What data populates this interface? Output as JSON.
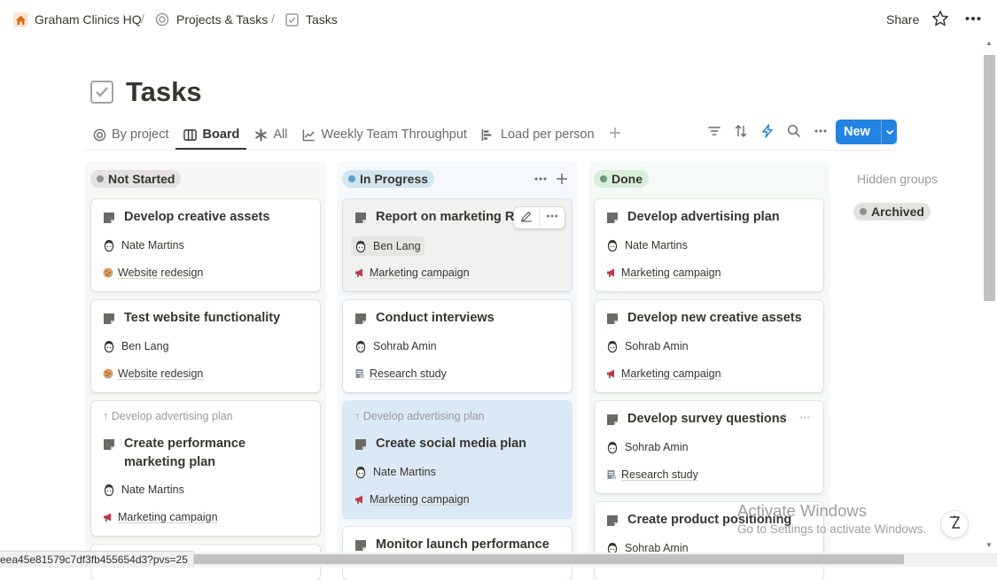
{
  "breadcrumb": {
    "workspace": "Graham Clinics HQ",
    "section": "Projects & Tasks",
    "page": "Tasks",
    "separator": "/"
  },
  "topbar": {
    "share_label": "Share"
  },
  "page": {
    "title": "Tasks"
  },
  "views": [
    {
      "label": "By project",
      "icon": "target-icon"
    },
    {
      "label": "Board",
      "icon": "board-icon",
      "active": true
    },
    {
      "label": "All",
      "icon": "asterisk-icon"
    },
    {
      "label": "Weekly Team Throughput",
      "icon": "line-chart-icon"
    },
    {
      "label": "Load per person",
      "icon": "bar-chart-icon"
    }
  ],
  "toolbar": {
    "new_label": "New"
  },
  "columns": [
    {
      "label": "Not Started",
      "dot_color": "#91918e",
      "pill_bg": "#e3e2e0",
      "cards": [
        {
          "title": "Develop creative assets",
          "assignee": "Nate Martins",
          "project": "Website redesign",
          "project_icon": "cookie-icon"
        },
        {
          "title": "Test website functionality",
          "assignee": "Ben Lang",
          "project": "Website redesign",
          "project_icon": "cookie-icon"
        },
        {
          "parent": "Develop advertising plan",
          "title": "Create performance marketing plan",
          "assignee": "Nate Martins",
          "project": "Marketing campaign",
          "project_icon": "megaphone-icon"
        }
      ]
    },
    {
      "label": "In Progress",
      "dot_color": "#5e9fd6",
      "pill_bg": "#d3e5ef",
      "cards": [
        {
          "title": "Report on marketing ROI",
          "assignee": "Ben Lang",
          "project": "Marketing campaign",
          "project_icon": "megaphone-icon"
        },
        {
          "title": "Conduct interviews",
          "assignee": "Sohrab Amin",
          "project": "Research study",
          "project_icon": "document-icon"
        },
        {
          "parent": "Develop advertising plan",
          "title": "Create social media plan",
          "assignee": "Nate Martins",
          "project": "Marketing campaign",
          "project_icon": "megaphone-icon"
        },
        {
          "title": "Monitor launch performance"
        }
      ]
    },
    {
      "label": "Done",
      "dot_color": "#6c9b7d",
      "pill_bg": "#dbeddb",
      "cards": [
        {
          "title": "Develop advertising plan",
          "assignee": "Nate Martins",
          "project": "Marketing campaign",
          "project_icon": "megaphone-icon"
        },
        {
          "title": "Develop new creative assets",
          "assignee": "Sohrab Amin",
          "project": "Marketing campaign",
          "project_icon": "megaphone-icon"
        },
        {
          "title": "Develop survey questions",
          "assignee": "Sohrab Amin",
          "project": "Research study",
          "project_icon": "document-icon"
        },
        {
          "title": "Create product positioning",
          "assignee": "Sohrab Amin"
        }
      ]
    }
  ],
  "hidden_groups": {
    "label": "Hidden groups",
    "items": [
      {
        "label": "Archived",
        "dot_color": "#91918e",
        "pill_bg": "#e3e2e0"
      }
    ]
  },
  "statusbar": {
    "url": "eea45e81579c7df3fb455654d3?pvs=25"
  },
  "watermark": {
    "line1": "Activate Windows",
    "line2": "Go to Settings to activate Windows."
  },
  "colors": {
    "accent": "#2383e2"
  }
}
